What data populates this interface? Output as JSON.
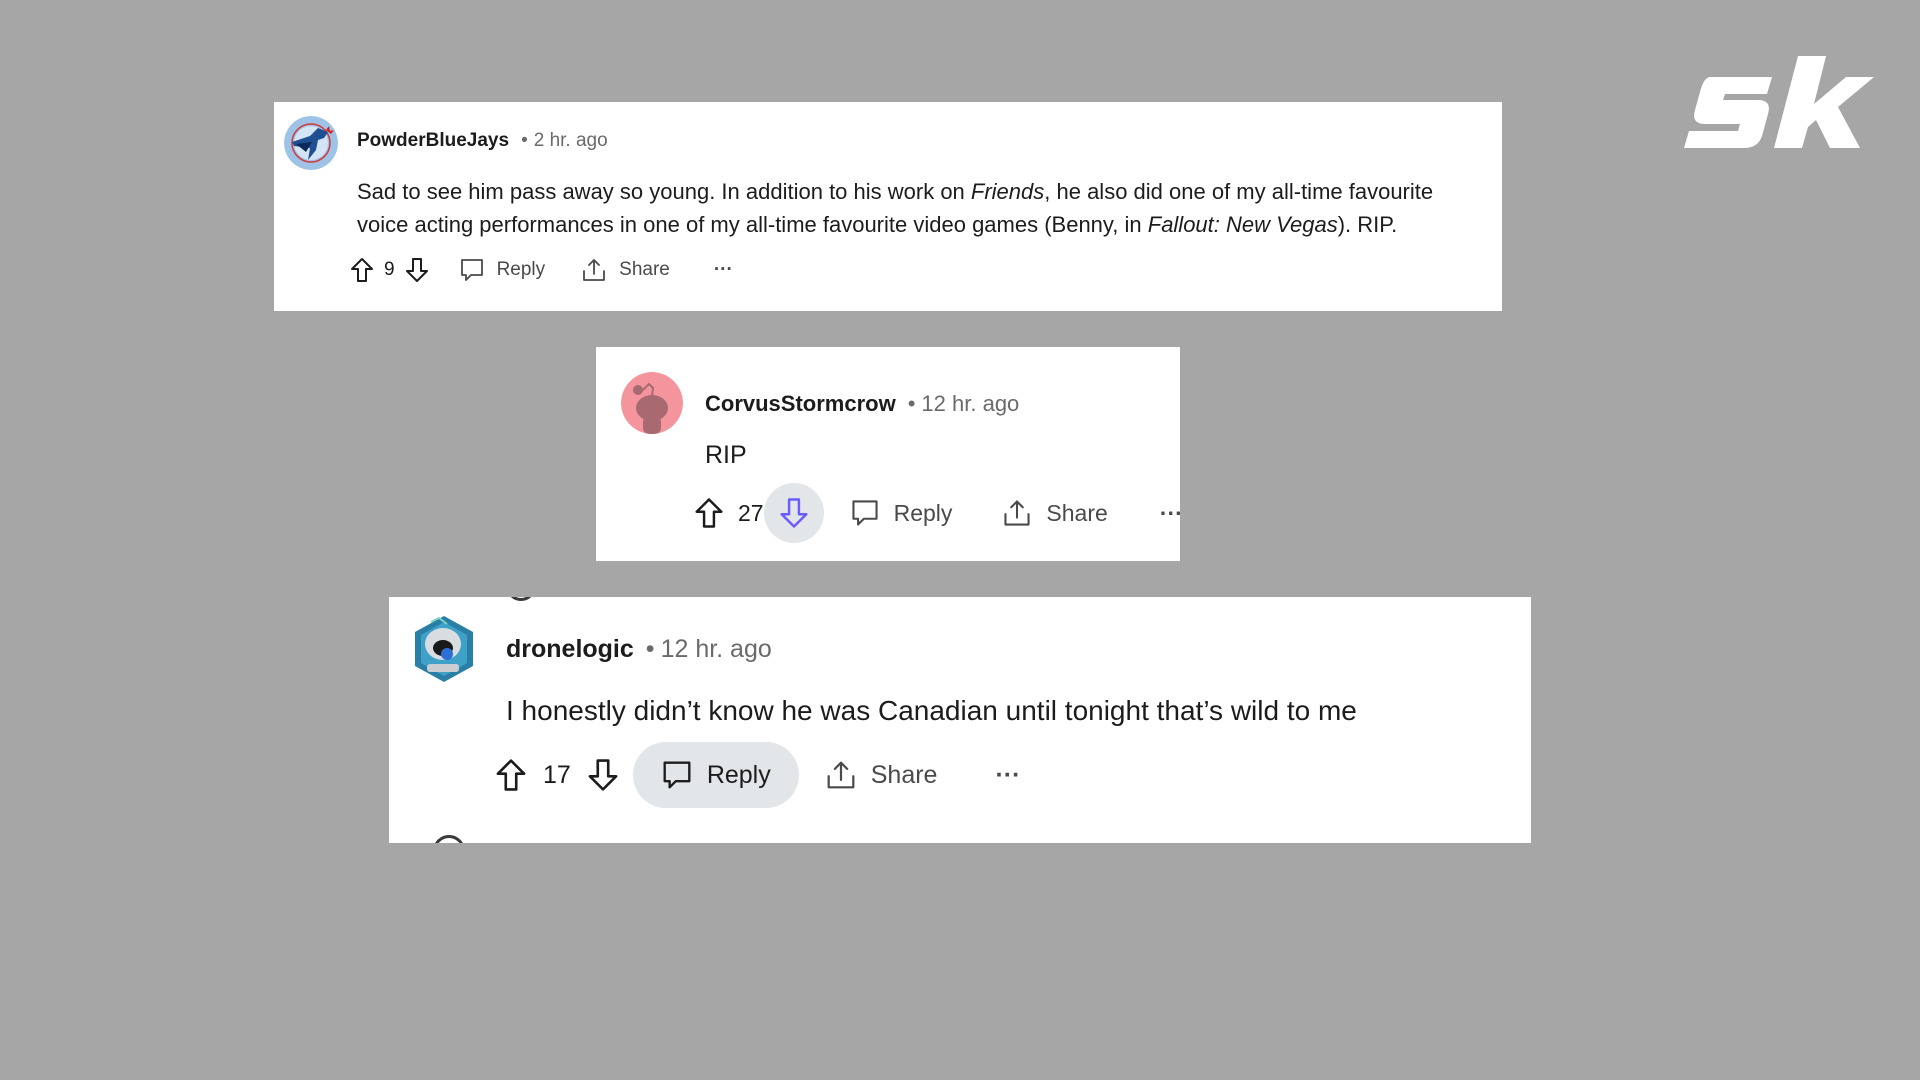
{
  "logo": {
    "text": "sk",
    "icon": "sportskeeda-logo",
    "color": "#ffffff"
  },
  "background_color": "#a6a6a6",
  "comments": [
    {
      "avatar": "blue-jays-logo-avatar",
      "username": "PowderBlueJays",
      "separator": "•",
      "time": "2 hr. ago",
      "body_line1_pre": "Sad to see him pass away so young. In addition to his work on ",
      "body_line1_italic": "Friends",
      "body_line1_post": ", he also did one of my all-time favourite",
      "body_line2_pre": "voice acting performances in one of my all-time favourite video games (Benny, in ",
      "body_line2_italic": "Fallout: New Vegas",
      "body_line2_post": "). RIP.",
      "votes": "9",
      "reply_label": "Reply",
      "share_label": "Share",
      "more_label": "···"
    },
    {
      "avatar": "snoo-avatar",
      "avatar_color": "#f4949c",
      "username": "CorvusStormcrow",
      "separator": "•",
      "time": "12 hr. ago",
      "body": "RIP",
      "votes": "27",
      "downvote_state": "hovered",
      "downvote_color": "#6a5cff",
      "reply_label": "Reply",
      "share_label": "Share",
      "more_label": "···"
    },
    {
      "avatar": "robot-hexagon-avatar",
      "username": "dronelogic",
      "separator": "•",
      "time": "12 hr. ago",
      "body": "I honestly didn’t know he was Canadian until tonight that’s wild to me",
      "votes": "17",
      "reply_state": "hovered",
      "reply_label": "Reply",
      "share_label": "Share",
      "more_label": "···"
    }
  ]
}
